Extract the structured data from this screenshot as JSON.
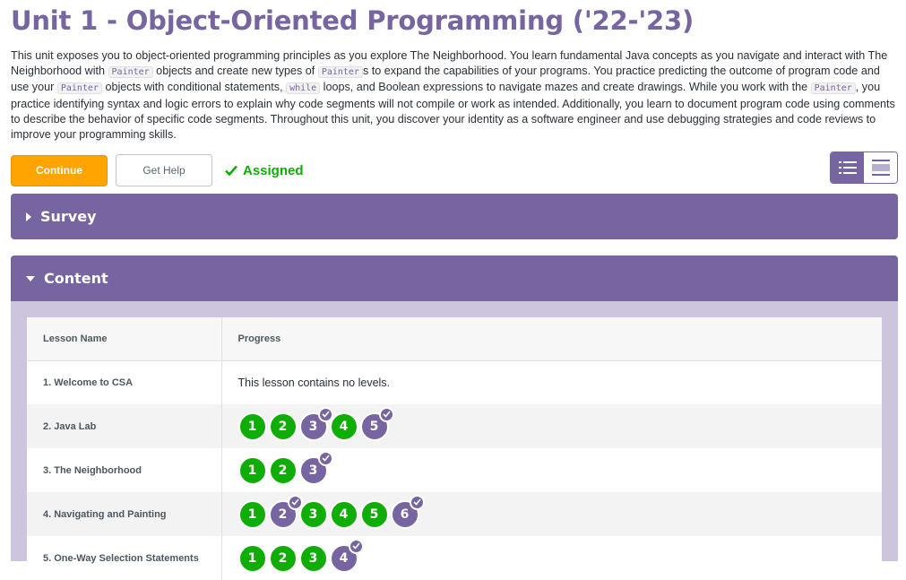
{
  "title": "Unit 1 - Object-Oriented Programming ('22-'23)",
  "description": {
    "p1": "This unit exposes you to object-oriented programming principles as you explore The Neighborhood. You learn fundamental Java concepts as you navigate and interact with The Neighborhood with ",
    "code1": "Painter",
    "p2": " objects and create new types of ",
    "code2": "Painter",
    "p3": "s to expand the capabilities of your programs. You practice predicting the outcome of program code and use your ",
    "code3": "Painter",
    "p4": " objects with conditional statements, ",
    "code4": "while",
    "p5": " loops, and Boolean expressions to navigate mazes and create drawings. While you work with the ",
    "code5": "Painter",
    "p6": ", you practice identifying syntax and logic errors to explain why code segments will not compile or work as intended. Additionally, you learn to document program code using comments to describe the behavior of specific code segments. Throughout this unit, you discover your identity as a software engineer and use debugging strategies and code reviews to improve your programming skills."
  },
  "actions": {
    "continue_label": "Continue",
    "help_label": "Get Help",
    "assigned_label": "Assigned"
  },
  "sections": {
    "survey": "Survey",
    "content": "Content"
  },
  "table": {
    "col_lesson": "Lesson Name",
    "col_progress": "Progress",
    "rows": [
      {
        "name": "1. Welcome to CSA",
        "note": "This lesson contains no levels."
      },
      {
        "name": "2. Java Lab"
      },
      {
        "name": "3. The Neighborhood"
      },
      {
        "name": "4. Navigating and Painting"
      },
      {
        "name": "5. One-Way Selection Statements"
      }
    ]
  },
  "progress": [
    [],
    [
      {
        "n": "1",
        "s": "green"
      },
      {
        "n": "2",
        "s": "green"
      },
      {
        "n": "3",
        "s": "purple-check"
      },
      {
        "n": "4",
        "s": "green"
      },
      {
        "n": "5",
        "s": "purple-check"
      }
    ],
    [
      {
        "n": "1",
        "s": "green"
      },
      {
        "n": "2",
        "s": "green"
      },
      {
        "n": "3",
        "s": "purple-check"
      }
    ],
    [
      {
        "n": "1",
        "s": "green"
      },
      {
        "n": "2",
        "s": "purple-check"
      },
      {
        "n": "3",
        "s": "green"
      },
      {
        "n": "4",
        "s": "green"
      },
      {
        "n": "5",
        "s": "green"
      },
      {
        "n": "6",
        "s": "purple-check"
      }
    ],
    [
      {
        "n": "1",
        "s": "green"
      },
      {
        "n": "2",
        "s": "green"
      },
      {
        "n": "3",
        "s": "green"
      },
      {
        "n": "4",
        "s": "purple-check"
      }
    ]
  ],
  "colors": {
    "brand_purple": "#7665a0",
    "complete_green": "#0fad05",
    "continue_orange": "#ffa400"
  }
}
